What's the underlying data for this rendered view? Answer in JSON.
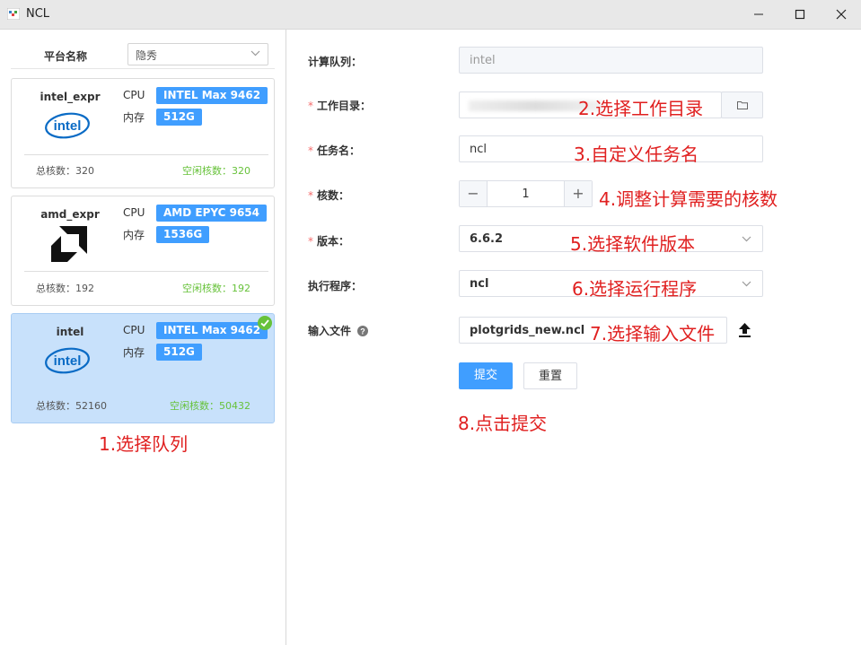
{
  "window": {
    "title": "NCL"
  },
  "platform": {
    "label": "平台名称",
    "selected": "隐秀"
  },
  "queues": [
    {
      "name": "intel_expr",
      "cpu_label": "CPU",
      "cpu": "INTEL Max 9462",
      "mem_label": "内存",
      "mem": "512G",
      "total": "总核数：320",
      "free": "空闲核数：320",
      "logo": "intel-logo",
      "selected": false
    },
    {
      "name": "amd_expr",
      "cpu_label": "CPU",
      "cpu": "AMD EPYC 9654",
      "mem_label": "内存",
      "mem": "1536G",
      "total": "总核数：192",
      "free": "空闲核数：192",
      "logo": "amd-logo",
      "selected": false
    },
    {
      "name": "intel",
      "cpu_label": "CPU",
      "cpu": "INTEL Max 9462",
      "mem_label": "内存",
      "mem": "512G",
      "total": "总核数：52160",
      "free": "空闲核数：50432",
      "logo": "intel-logo",
      "selected": true
    }
  ],
  "form": {
    "queue_label": "计算队列：",
    "queue_value": "intel",
    "workdir_label": "工作目录：",
    "jobname_label": "任务名：",
    "jobname_value": "ncl",
    "cores_label": "核数：",
    "cores_value": "1",
    "version_label": "版本：",
    "version_value": "6.6.2",
    "program_label": "执行程序：",
    "program_value": "ncl",
    "input_label": "输入文件",
    "input_value": "plotgrids_new.ncl",
    "submit": "提交",
    "reset": "重置"
  },
  "annotations": {
    "a1": "1.选择队列",
    "a2": "2.选择工作目录",
    "a3": "3.自定义任务名",
    "a4": "4.调整计算需要的核数",
    "a5": "5.选择软件版本",
    "a6": "6.选择运行程序",
    "a7": "7.选择输入文件",
    "a8": "8.点击提交"
  },
  "colors": {
    "primary": "#409eff",
    "success": "#67c23a",
    "annotation": "#e02020",
    "selected_card": "#c8e1fb"
  }
}
